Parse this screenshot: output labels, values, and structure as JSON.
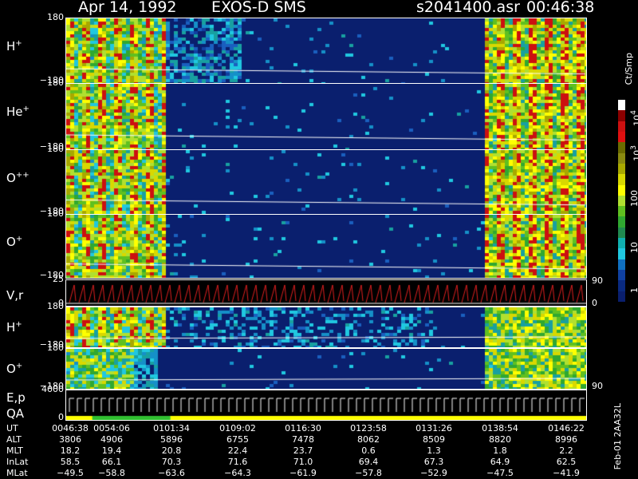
{
  "header": {
    "date": "Apr 14, 1992",
    "instrument": "EXOS-D SMS",
    "file": "s2041400.asr",
    "time": "00:46:38"
  },
  "panels": [
    {
      "id": "h1",
      "label": "H",
      "sup": "+",
      "tick_top": "180",
      "tick_bot": "−180"
    },
    {
      "id": "he",
      "label": "He",
      "sup": "+",
      "tick_top": "180",
      "tick_bot": "−180"
    },
    {
      "id": "opp",
      "label": "O",
      "sup": "++",
      "tick_top": "180",
      "tick_bot": "−180"
    },
    {
      "id": "o1",
      "label": "O",
      "sup": "+",
      "tick_top": "180",
      "tick_bot": "−180"
    },
    {
      "id": "vr",
      "label": "V,r",
      "sup": "",
      "tick_top": "25",
      "tick_bot": "0",
      "right_top": "90",
      "right_bot": "0"
    },
    {
      "id": "h2",
      "label": "H",
      "sup": "+",
      "tick_top": "180",
      "tick_bot": "−180"
    },
    {
      "id": "o2",
      "label": "O",
      "sup": "+",
      "tick_top": "180",
      "tick_bot": "−180",
      "right_bot": "90"
    },
    {
      "id": "ep",
      "label": "E,p",
      "sup": "",
      "tick_top": "4000",
      "tick_bot": "0",
      "label2": "QA"
    }
  ],
  "colorbar": {
    "unit": "Ct/Smp",
    "ticks": [
      "10",
      "4",
      "10",
      "3",
      "100",
      "10",
      "1"
    ],
    "tick_labels": {
      "t1": "10",
      "t1sup": "4",
      "t2": "10",
      "t2sup": "3",
      "t3": "100",
      "t4": "10",
      "t5": "1"
    },
    "colors": [
      "#ffffff",
      "#8b0000",
      "#cc1010",
      "#e01010",
      "#6b6b00",
      "#8a8a10",
      "#a8a800",
      "#d8d800",
      "#ffff00",
      "#b0e030",
      "#60c020",
      "#30a830",
      "#208a50",
      "#10b0b0",
      "#20c8e0",
      "#1070c0",
      "#1040a0",
      "#0a2a80",
      "#0a1f6e"
    ]
  },
  "time_table": {
    "labels": [
      "UT",
      "ALT",
      "MLT",
      "InLat",
      "MLat"
    ],
    "rows": {
      "UT": [
        "0046:38",
        "0054:06",
        "0101:34",
        "0109:02",
        "0116:30",
        "0123:58",
        "0131:26",
        "0138:54",
        "0146:22"
      ],
      "ALT": [
        "3806",
        "4906",
        "5896",
        "6755",
        "7478",
        "8062",
        "8509",
        "8820",
        "8996"
      ],
      "MLT": [
        "18.2",
        "19.4",
        "20.8",
        "22.4",
        "23.7",
        "0.6",
        "1.3",
        "1.8",
        "2.2"
      ],
      "InLat": [
        "58.5",
        "66.1",
        "70.3",
        "71.6",
        "71.0",
        "69.4",
        "67.3",
        "64.9",
        "62.5"
      ],
      "MLat": [
        "−49.5",
        "−58.8",
        "−63.6",
        "−64.3",
        "−61.9",
        "−57.8",
        "−52.9",
        "−47.5",
        "−41.9"
      ]
    }
  },
  "footer_vertical": "Feb-01 2AA32L",
  "chart_data": {
    "type": "heatmap",
    "title": "Apr 14, 1992 EXOS-D SMS",
    "x": [
      "0046:38",
      "0054:06",
      "0101:34",
      "0109:02",
      "0116:30",
      "0123:58",
      "0131:26",
      "0138:54",
      "0146:22"
    ],
    "panels": [
      "H+",
      "He+",
      "O++",
      "O+",
      "V,r",
      "H+",
      "O+",
      "E,p"
    ],
    "colorbar_unit": "Ct/Smp",
    "colorbar_range": [
      1,
      10000
    ],
    "colorbar_scale": "log"
  }
}
